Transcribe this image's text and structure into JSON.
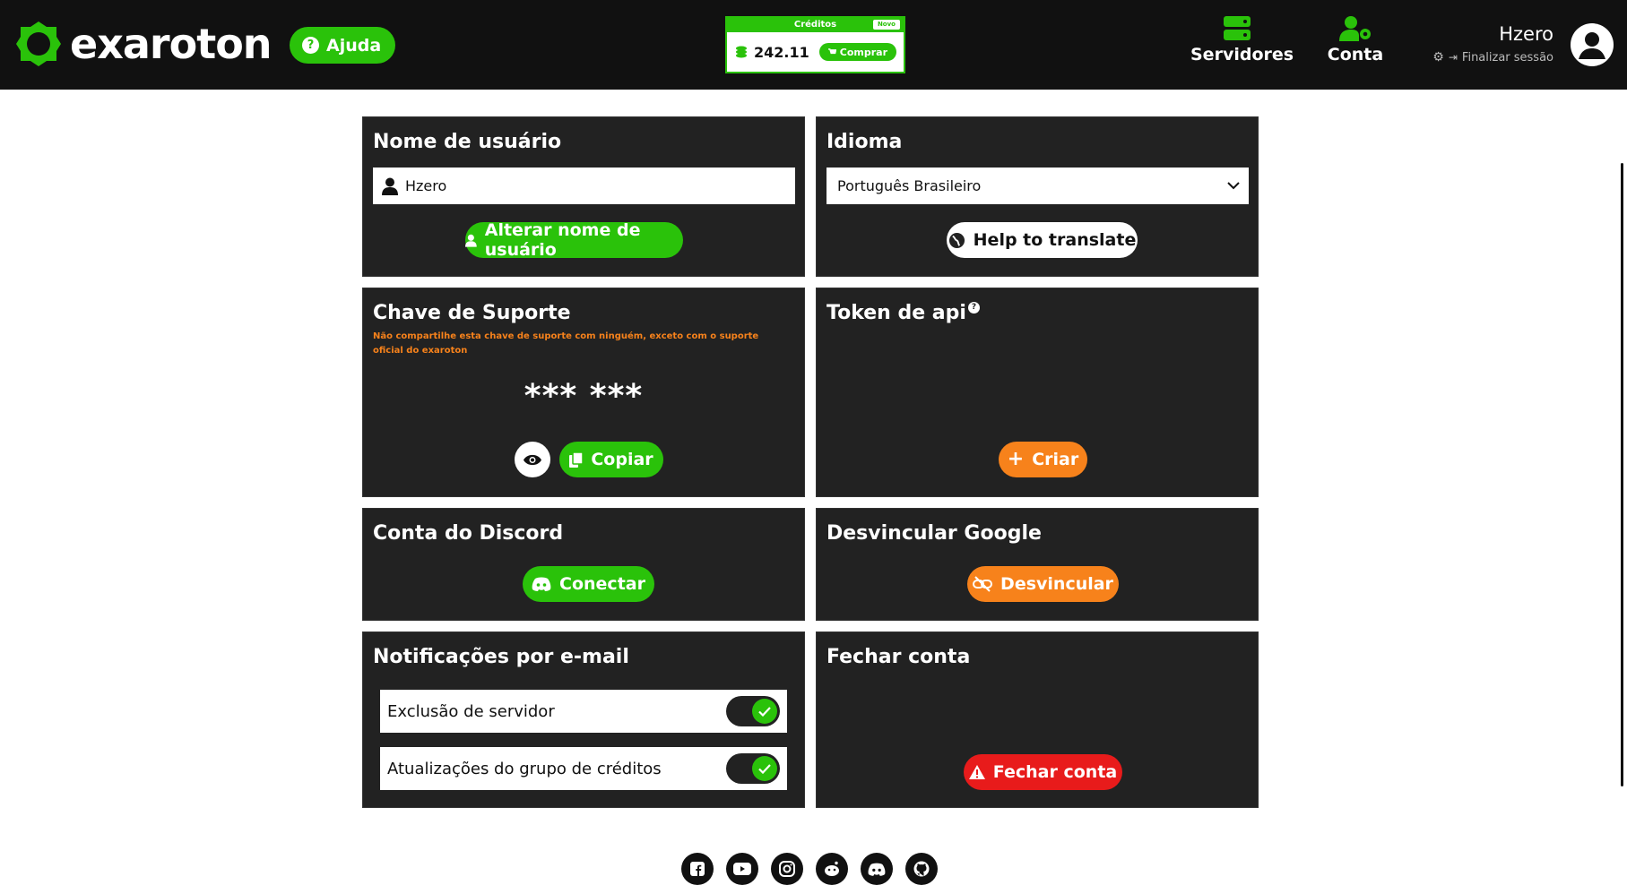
{
  "brand": {
    "name": "exaroton",
    "accent": "#2ac20a",
    "orange": "#f7821b",
    "red": "#e81b1b"
  },
  "header": {
    "help_label": "Ajuda",
    "credits": {
      "title": "Créditos",
      "new_badge": "Novo",
      "amount": "242.11",
      "buy_label": "Comprar"
    },
    "nav": {
      "servers_label": "Servidores",
      "account_label": "Conta"
    },
    "user": {
      "name": "Hzero",
      "logout_label": "Finalizar sessão"
    }
  },
  "username_card": {
    "title": "Nome de usuário",
    "value": "Hzero",
    "change_button": "Alterar nome de usuário"
  },
  "language_card": {
    "title": "Idioma",
    "selected": "Português Brasileiro",
    "translate_button": "Help to translate"
  },
  "support_key_card": {
    "title": "Chave de Suporte",
    "warning": "Não compartilhe esta chave de suporte com ninguém, exceto com o suporte oficial do exaroton",
    "masked_key": "*** ***",
    "copy_button": "Copiar"
  },
  "api_token_card": {
    "title": "Token de api",
    "help_mark": "?",
    "create_button": "Criar"
  },
  "discord_card": {
    "title": "Conta do Discord",
    "connect_button": "Conectar"
  },
  "google_card": {
    "title": "Desvincular Google",
    "unlink_button": "Desvincular"
  },
  "notifications_card": {
    "title": "Notificações por e-mail",
    "items": [
      {
        "label": "Exclusão de servidor",
        "enabled": true
      },
      {
        "label": "Atualizações do grupo de créditos",
        "enabled": true
      }
    ]
  },
  "close_account_card": {
    "title": "Fechar conta",
    "close_button": "Fechar conta"
  },
  "footer": {
    "socials": [
      "facebook-icon",
      "youtube-icon",
      "instagram-icon",
      "reddit-icon",
      "discord-icon",
      "github-icon"
    ]
  }
}
